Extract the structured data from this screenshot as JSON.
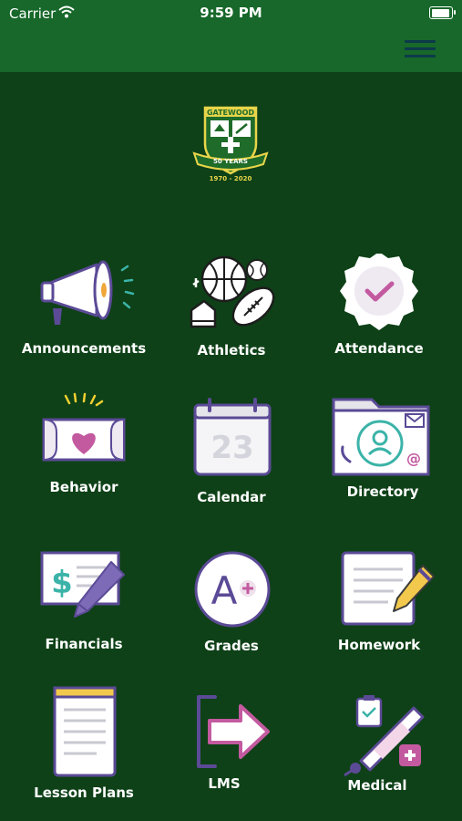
{
  "status_bar": {
    "carrier": "Carrier",
    "time": "9:59 PM",
    "battery_level": 0.95
  },
  "header": {
    "menu_icon": "hamburger-menu-icon"
  },
  "logo": {
    "name": "GATEWOOD",
    "ribbon": "50 YEARS",
    "years": "1970 - 2020"
  },
  "colors": {
    "background": "#0e4117",
    "header": "#17682a",
    "accent_purple": "#5b4a96",
    "accent_pink": "#d47bb5",
    "accent_teal": "#3bb3a8"
  },
  "tiles": [
    {
      "label": "Announcements",
      "icon": "megaphone-icon"
    },
    {
      "label": "Athletics",
      "icon": "sports-balls-icon"
    },
    {
      "label": "Attendance",
      "icon": "checkmark-badge-icon"
    },
    {
      "label": "Behavior",
      "icon": "heart-ticket-icon"
    },
    {
      "label": "Calendar",
      "icon": "calendar-icon",
      "calendar_day": "23"
    },
    {
      "label": "Directory",
      "icon": "contact-folder-icon"
    },
    {
      "label": "Financials",
      "icon": "invoice-pen-icon"
    },
    {
      "label": "Grades",
      "icon": "grade-circle-icon",
      "grade": "A"
    },
    {
      "label": "Homework",
      "icon": "notepad-pencil-icon"
    },
    {
      "label": "Lesson Plans",
      "icon": "clipboard-sheet-icon"
    },
    {
      "label": "LMS",
      "icon": "login-arrow-icon"
    },
    {
      "label": "Medical",
      "icon": "thermometer-clipboard-icon"
    }
  ]
}
